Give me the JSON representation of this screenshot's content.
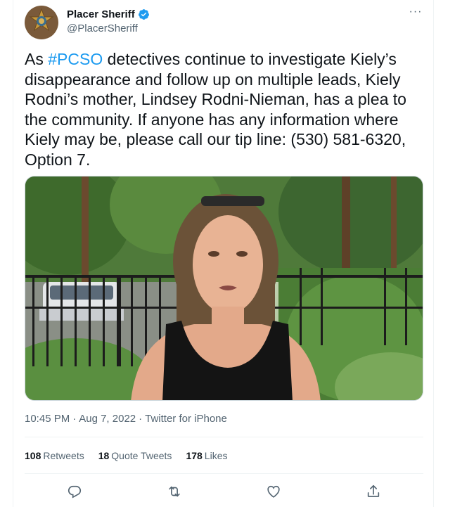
{
  "tweet": {
    "author": {
      "display_name": "Placer Sheriff",
      "handle": "@PlacerSheriff",
      "verified": true
    },
    "text": {
      "before": "As ",
      "hashtag": "#PCSO",
      "after": " detectives continue to investigate Kiely’s disappearance and follow up on multiple leads, Kiely Rodni’s mother, Lindsey Rodni-Nieman, has a plea to the community. If anyone has any information where Kiely may be, please call our tip line: (530) 581-6320, Option 7."
    },
    "meta": {
      "time": "10:45 PM",
      "separator1": "·",
      "date": "Aug 7, 2022",
      "separator2": "·",
      "source": "Twitter for iPhone"
    },
    "stats": {
      "retweets_count": "108",
      "retweets_label": "Retweets",
      "quotes_count": "18",
      "quotes_label": "Quote Tweets",
      "likes_count": "178",
      "likes_label": "Likes"
    },
    "more_glyph": "···"
  },
  "icons": {
    "more": "more-icon",
    "verified": "verified-badge-icon",
    "reply": "reply-icon",
    "retweet": "retweet-icon",
    "like": "like-icon",
    "share": "share-icon"
  },
  "colors": {
    "accent": "#1d9bf0",
    "text": "#0f1419",
    "secondary": "#536471",
    "border": "#eff3f4"
  }
}
